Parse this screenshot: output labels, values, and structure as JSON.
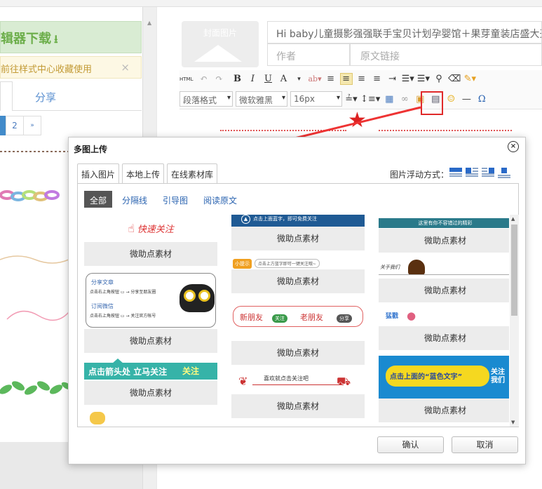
{
  "left_panel": {
    "download_banner": "辑器下载",
    "notice_text": "前往样式中心收藏使用",
    "notice_close": "×",
    "tab_share": "分享",
    "pager": [
      "2",
      "»"
    ]
  },
  "editor": {
    "cover_label": "封面图片",
    "title_value": "Hi baby儿童摄影强强联手宝贝计划孕婴馆＋果芽童装店盛大开",
    "author_placeholder": "作者",
    "source_link_placeholder": "原文链接",
    "toolbar": {
      "html_label": "HTML",
      "bold": "B",
      "italic": "I",
      "underline": "U",
      "font_color": "A",
      "paragraph_format": "段落格式",
      "font_family": "微软雅黑",
      "font_size": "16px",
      "omega": "Ω"
    }
  },
  "dialog": {
    "title": "多图上传",
    "close": "×",
    "tabs": [
      {
        "label": "插入图片",
        "active": false
      },
      {
        "label": "本地上传",
        "active": false
      },
      {
        "label": "在线素材库",
        "active": true
      }
    ],
    "float_label": "图片浮动方式：",
    "filters": [
      {
        "label": "全部",
        "active": true
      },
      {
        "label": "分隔线",
        "active": false
      },
      {
        "label": "引导图",
        "active": false
      },
      {
        "label": "阅读原文",
        "active": false
      }
    ],
    "item_caption": "微助点素材",
    "items": {
      "c1_1": "快速关注",
      "c1_2a": "分享文章",
      "c1_2b": "点击右上角按钮 ▭ → 分享至朋友圈",
      "c1_2c": "订阅微信",
      "c1_2d": "点击右上角按钮 ▭ → 关注官方帐号",
      "c1_3": "点击箭头处 立马关注",
      "c1_3b": "关注",
      "c2_1": "点击上面蓝字，即可免费关注",
      "c2_2a": "小提示",
      "c2_2b": "点击上方蓝字即可一键关注哦~",
      "c2_3a": "新朋友",
      "c2_3b": "关注",
      "c2_3c": "老朋友",
      "c2_3d": "分享",
      "c2_4": "喜欢就点击关注吧",
      "c3_1": "这里有你不容错过的精彩",
      "c3_2": "关于我们",
      "c3_3": "猛戳",
      "c3_4a": "点击上面的“蓝色文字”",
      "c3_4b": "关注我们"
    },
    "ok": "确认",
    "cancel": "取消"
  },
  "colors": {
    "accent_blue": "#2a63b0",
    "highlight_red": "#e02a2a",
    "download_green": "#6cae4a",
    "dark_blue": "#1f5a94",
    "teal": "#36b3a8",
    "leaf_green": "#5cb85c"
  }
}
